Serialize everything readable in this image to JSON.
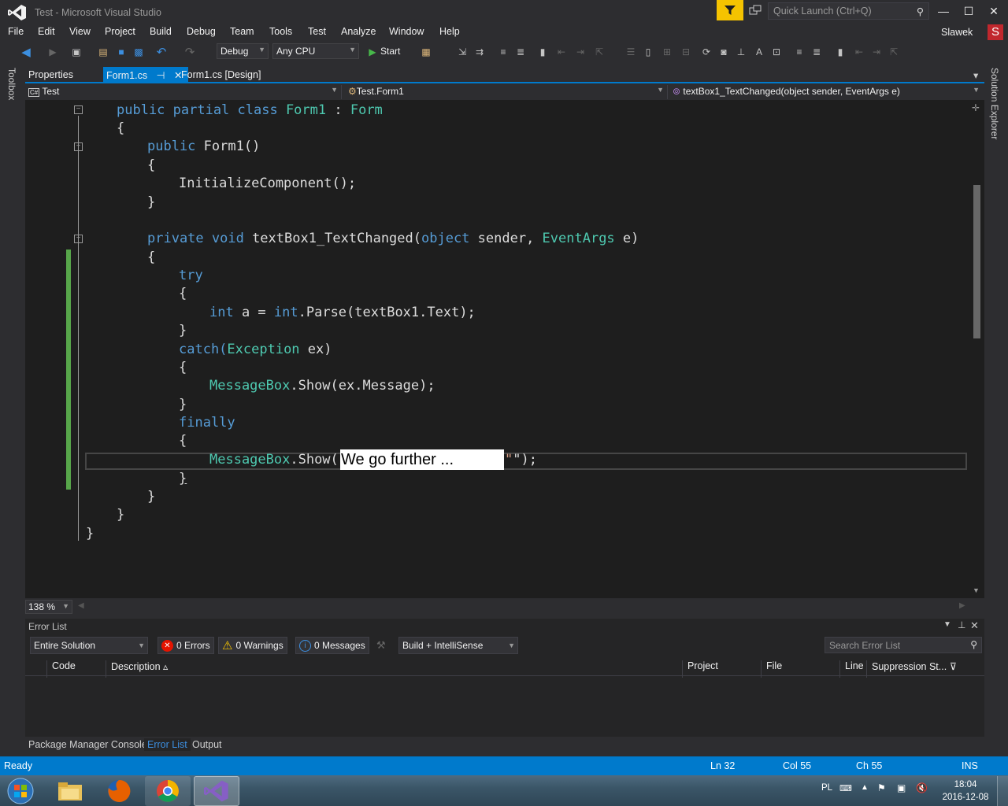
{
  "window": {
    "title": "Test - Microsoft Visual Studio",
    "quick_launch_placeholder": "Quick Launch (Ctrl+Q)",
    "user": "Slawek",
    "avatar_letter": "S"
  },
  "menu": [
    "File",
    "Edit",
    "View",
    "Project",
    "Build",
    "Debug",
    "Team",
    "Tools",
    "Test",
    "Analyze",
    "Window",
    "Help"
  ],
  "toolbar": {
    "config": "Debug",
    "platform": "Any CPU",
    "start_label": "Start"
  },
  "side": {
    "toolbox": "Toolbox",
    "solution_explorer": "Solution Explorer"
  },
  "tabs": {
    "properties": "Properties",
    "form1cs": "Form1.cs",
    "pin": "⊣",
    "form1design": "Form1.cs [Design]"
  },
  "nav": {
    "project": "Test",
    "class": "Test.Form1",
    "member": "textBox1_TextChanged(object sender, EventArgs e)"
  },
  "code": {
    "l1a": "public partial class ",
    "l1b": "Form1",
    "l1c": " : ",
    "l1d": "Form",
    "brace_open": "{",
    "brace_close": "}",
    "l3a": "public ",
    "l3b": "Form1()",
    "l5": "InitializeComponent();",
    "l8a": "private void ",
    "l8b": "textBox1_TextChanged(",
    "l8c": "object",
    "l8d": " sender, ",
    "l8e": "EventArgs",
    "l8f": " e)",
    "try": "try",
    "l12a": "int",
    "l12b": " a = ",
    "l12c": "int",
    "l12d": ".Parse(textBox1.Text);",
    "catch_a": "catch(",
    "catch_b": "Exception",
    "catch_c": " ex)",
    "mb": "MessageBox",
    "show1": ".Show(ex.Message);",
    "finally": "finally",
    "show2a": ".Show(",
    "quote": "\"",
    "show2b": "\");",
    "highlight": "We go further ..."
  },
  "zoom": "138 %",
  "errorlist": {
    "title": "Error List",
    "scope": "Entire Solution",
    "errors": "0 Errors",
    "warnings": "0 Warnings",
    "messages": "0 Messages",
    "build_filter": "Build + IntelliSense",
    "search_placeholder": "Search Error List",
    "columns": [
      "Code",
      "Description",
      "Project",
      "File",
      "Line",
      "Suppression St..."
    ]
  },
  "bottom_tabs": [
    "Package Manager Console",
    "Error List",
    "Output"
  ],
  "status": {
    "ready": "Ready",
    "ln": "Ln 32",
    "col": "Col 55",
    "ch": "Ch 55",
    "ins": "INS"
  },
  "tray": {
    "lang": "PL",
    "time": "18:04",
    "date": "2016-12-08"
  },
  "colors": {
    "accent": "#007acc",
    "keyword": "#569cd6",
    "type": "#4ec9b0",
    "string": "#d69d85"
  }
}
